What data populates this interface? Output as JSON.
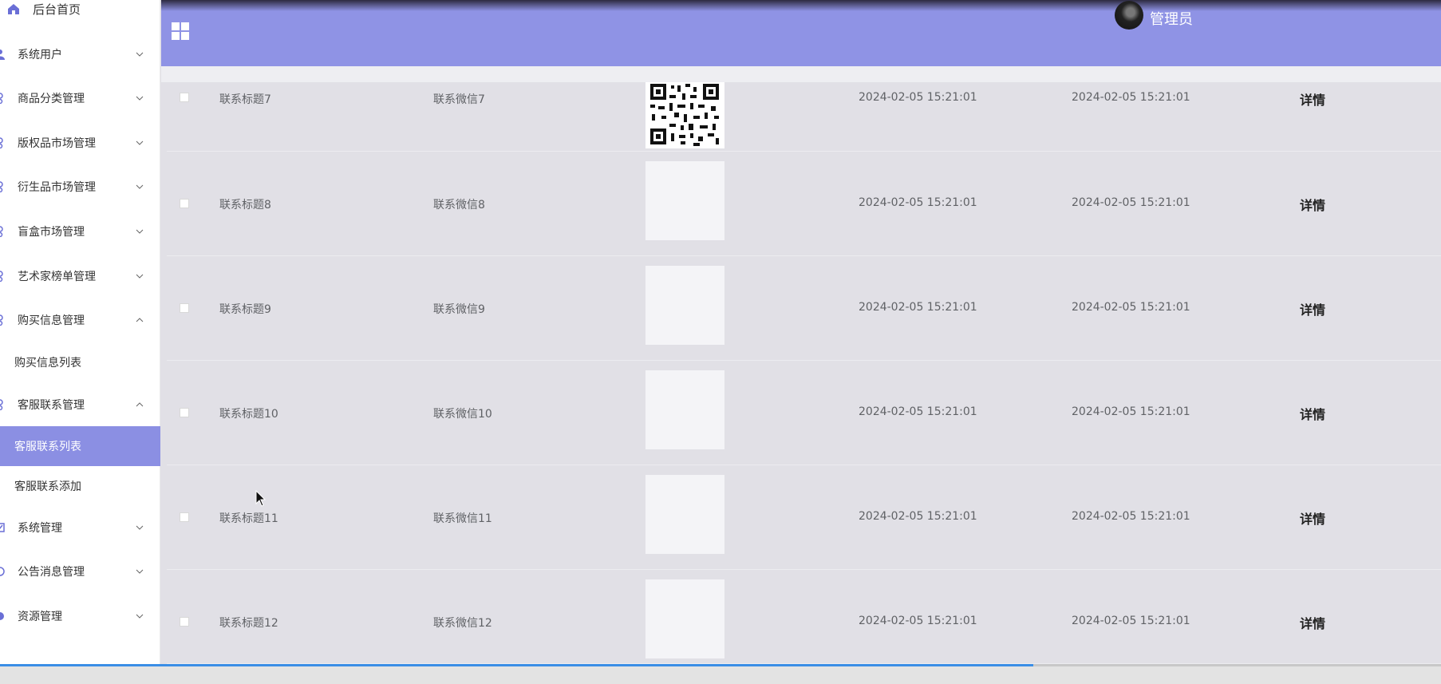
{
  "sidebar": {
    "home": "后台首页",
    "items": [
      {
        "label": "系统用户",
        "expanded": false
      },
      {
        "label": "商品分类管理",
        "expanded": false
      },
      {
        "label": "版权品市场管理",
        "expanded": false
      },
      {
        "label": "衍生品市场管理",
        "expanded": false
      },
      {
        "label": "盲盒市场管理",
        "expanded": false
      },
      {
        "label": "艺术家榜单管理",
        "expanded": false
      },
      {
        "label": "购买信息管理",
        "expanded": true
      },
      {
        "label": "客服联系管理",
        "expanded": true
      },
      {
        "label": "系统管理",
        "expanded": false
      },
      {
        "label": "公告消息管理",
        "expanded": false
      },
      {
        "label": "资源管理",
        "expanded": false
      }
    ],
    "subitems": {
      "purchase_list": "购买信息列表",
      "service_list": "客服联系列表",
      "service_add": "客服联系添加"
    },
    "active_subitem": "客服联系列表"
  },
  "header": {
    "admin_name": "管理员",
    "accent_color": "#8f93e5"
  },
  "table": {
    "detail_label": "详情",
    "rows": [
      {
        "title": "联系标题7",
        "wechat": "联系微信7",
        "qr": true,
        "created": "2024-02-05 15:21:01",
        "updated": "2024-02-05 15:21:01"
      },
      {
        "title": "联系标题8",
        "wechat": "联系微信8",
        "qr": false,
        "created": "2024-02-05 15:21:01",
        "updated": "2024-02-05 15:21:01"
      },
      {
        "title": "联系标题9",
        "wechat": "联系微信9",
        "qr": false,
        "created": "2024-02-05 15:21:01",
        "updated": "2024-02-05 15:21:01"
      },
      {
        "title": "联系标题10",
        "wechat": "联系微信10",
        "qr": false,
        "created": "2024-02-05 15:21:01",
        "updated": "2024-02-05 15:21:01"
      },
      {
        "title": "联系标题11",
        "wechat": "联系微信11",
        "qr": false,
        "created": "2024-02-05 15:21:01",
        "updated": "2024-02-05 15:21:01"
      },
      {
        "title": "联系标题12",
        "wechat": "联系微信12",
        "qr": false,
        "created": "2024-02-05 15:21:01",
        "updated": "2024-02-05 15:21:01"
      }
    ]
  }
}
